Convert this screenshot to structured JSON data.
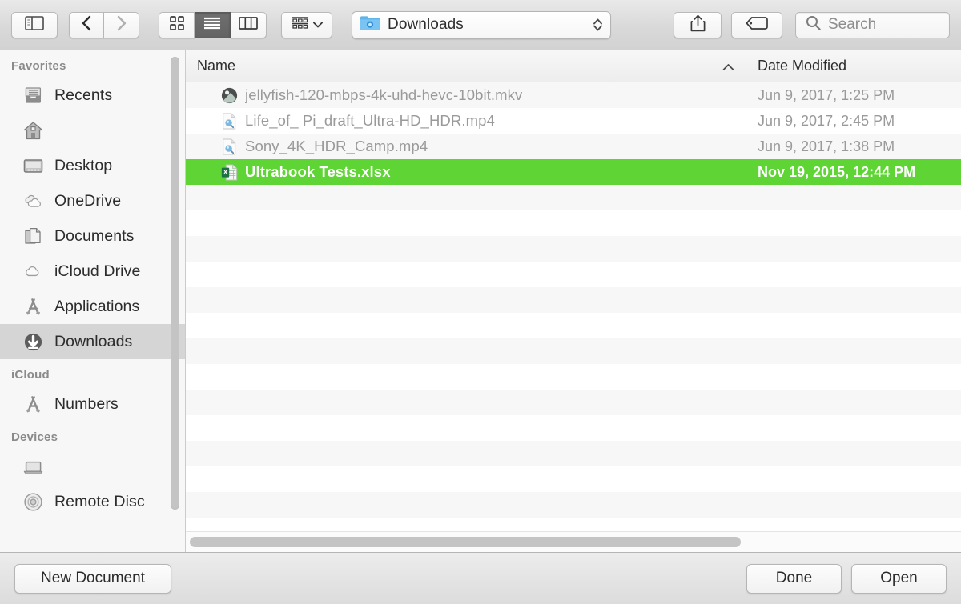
{
  "toolbar": {
    "sidebar_toggle_icon": "sidebar-toggle-icon",
    "back_icon": "chevron-left-icon",
    "forward_icon": "chevron-right-icon",
    "view_icon_grid": "icon-view-icon",
    "view_icon_list": "list-view-icon",
    "view_icon_column": "column-view-icon",
    "action_menu_icon": "action-menu-icon",
    "action_menu_chevron": "chevron-down-icon",
    "path_folder_icon": "downloads-folder-icon",
    "path_label": "Downloads",
    "path_stepper_icon": "stepper-up-down-icon",
    "share_icon": "share-icon",
    "tag_icon": "tag-icon",
    "search_icon": "search-icon",
    "search_placeholder": "Search",
    "search_value": ""
  },
  "sidebar": {
    "sections": [
      {
        "title": "Favorites",
        "items": [
          {
            "label": "Recents",
            "icon": "recents-icon",
            "selected": false
          },
          {
            "label": "",
            "icon": "home-icon",
            "selected": false
          },
          {
            "label": "Desktop",
            "icon": "desktop-icon",
            "selected": false
          },
          {
            "label": "OneDrive",
            "icon": "onedrive-icon",
            "selected": false
          },
          {
            "label": "Documents",
            "icon": "documents-icon",
            "selected": false
          },
          {
            "label": "iCloud Drive",
            "icon": "icloud-icon",
            "selected": false
          },
          {
            "label": "Applications",
            "icon": "applications-icon",
            "selected": false
          },
          {
            "label": "Downloads",
            "icon": "downloads-icon",
            "selected": true
          }
        ]
      },
      {
        "title": "iCloud",
        "items": [
          {
            "label": "Numbers",
            "icon": "numbers-icon",
            "selected": false
          }
        ]
      },
      {
        "title": "Devices",
        "items": [
          {
            "label": "",
            "icon": "laptop-icon",
            "selected": false
          },
          {
            "label": "Remote Disc",
            "icon": "remote-disc-icon",
            "selected": false
          }
        ]
      }
    ]
  },
  "file_list": {
    "columns": [
      {
        "label": "Name",
        "sort": "ascending",
        "sort_icon": "chevron-up-icon"
      },
      {
        "label": "Date Modified",
        "sort": "none"
      }
    ],
    "rows": [
      {
        "name": "jellyfish-120-mbps-4k-uhd-hevc-10bit.mkv",
        "date": "Jun 9, 2017, 1:25 PM",
        "icon": "mkv-file-icon",
        "selected": false,
        "disabled": true
      },
      {
        "name": "Life_of_ Pi_draft_Ultra-HD_HDR.mp4",
        "date": "Jun 9, 2017, 2:45 PM",
        "icon": "mp4-file-icon",
        "selected": false,
        "disabled": true
      },
      {
        "name": "Sony_4K_HDR_Camp.mp4",
        "date": "Jun 9, 2017, 1:38 PM",
        "icon": "mp4-file-icon",
        "selected": false,
        "disabled": true
      },
      {
        "name": "Ultrabook Tests.xlsx",
        "date": "Nov 19, 2015, 12:44 PM",
        "icon": "xlsx-file-icon",
        "selected": true,
        "disabled": false
      }
    ]
  },
  "footer": {
    "new_document_label": "New Document",
    "done_label": "Done",
    "open_label": "Open"
  },
  "colors": {
    "selection_green": "#5fd535",
    "sidebar_selected_gray": "#d5d5d5",
    "folder_blue": "#4aa8e8",
    "excel_green": "#1d7144"
  }
}
